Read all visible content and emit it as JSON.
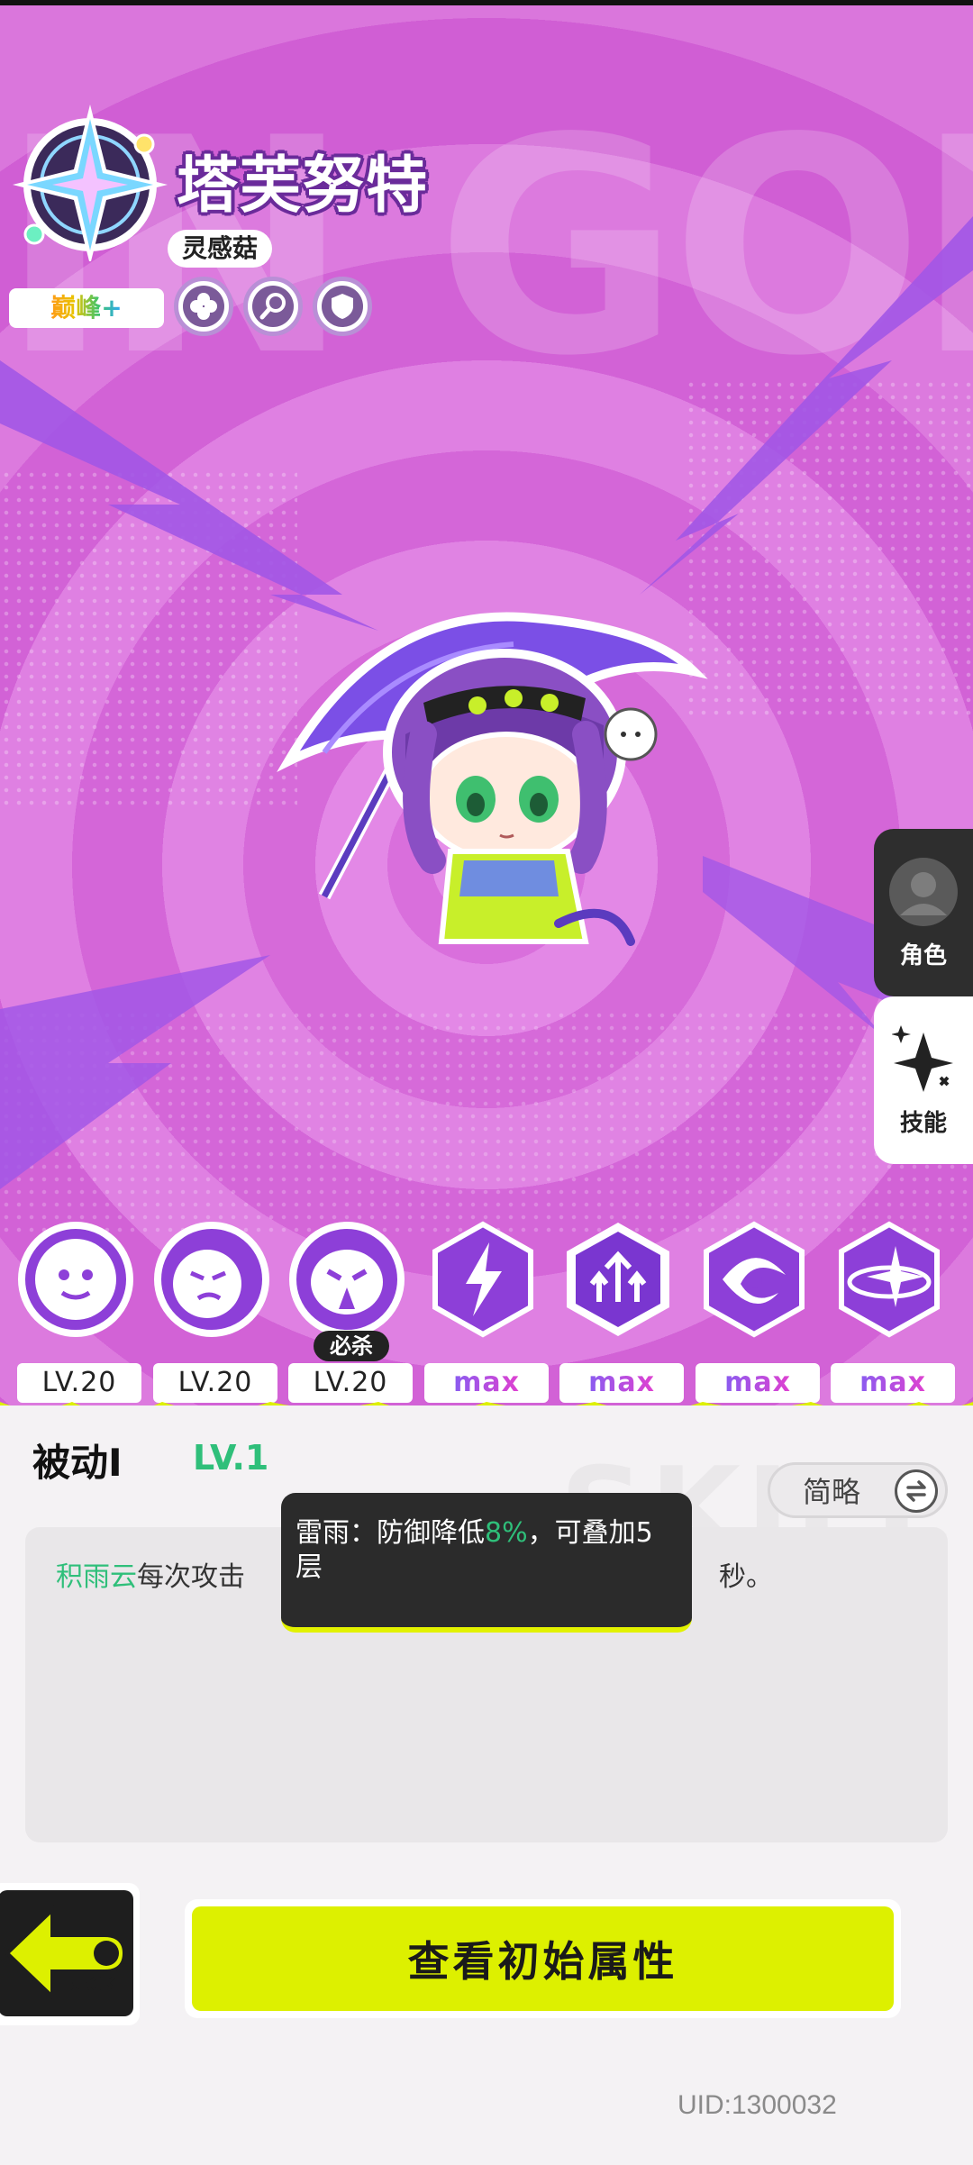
{
  "character": {
    "name": "塔芙努特",
    "faction": "灵感菇",
    "rank": "巅峰+"
  },
  "background": {
    "watermark": "IN GOD"
  },
  "side_tabs": [
    {
      "label": "角色",
      "icon": "avatar-icon"
    },
    {
      "label": "技能",
      "icon": "sparkle-icon"
    }
  ],
  "skills": [
    {
      "level": "LV.20",
      "icon": "splash-face-icon"
    },
    {
      "level": "LV.20",
      "icon": "angry-cloud-icon"
    },
    {
      "level": "LV.20",
      "icon": "storm-face-icon"
    },
    {
      "level": "max",
      "icon": "lightning-badge-icon"
    },
    {
      "level": "max",
      "icon": "rising-arrows-icon"
    },
    {
      "level": "max",
      "icon": "vortex-icon"
    },
    {
      "level": "max",
      "icon": "star-orbit-icon"
    }
  ],
  "ult_tag": "必杀",
  "panel": {
    "skill_title": "被动Ⅰ",
    "skill_level": "LV.1",
    "watermark": "SKILL",
    "simple_toggle": "简略",
    "desc_highlight": "积雨云",
    "desc_text": "每次攻击",
    "desc_tail": "秒。",
    "tooltip": {
      "prefix": "雷雨：防御降低",
      "value": "8%",
      "suffix": "，可叠加5层"
    },
    "back_label": "BACK",
    "main_button": "查看初始属性",
    "uid": "UID:1300032"
  },
  "colors": {
    "accent_lime": "#ddf000",
    "highlight_green": "#2fbf7a",
    "max_purple": "#c24ce0"
  }
}
